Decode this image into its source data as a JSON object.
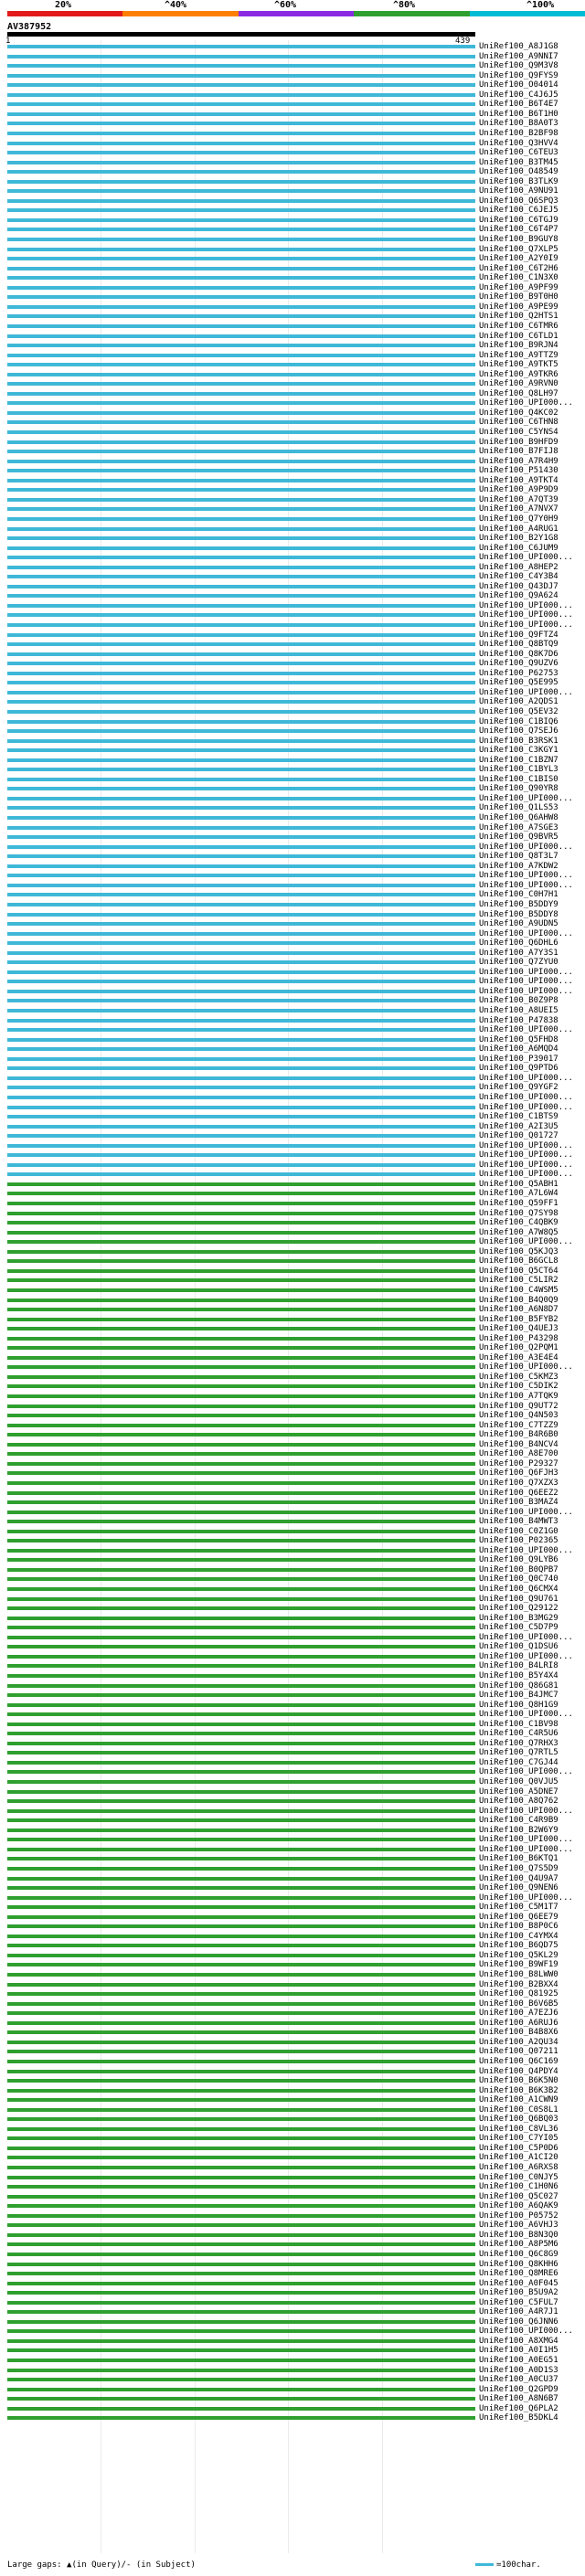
{
  "scale_labels": [
    "20%",
    "^40%",
    "^60%",
    "^80%",
    "^100%"
  ],
  "colorbar": [
    "#e31a1c",
    "#ff7f00",
    "#8a2be2",
    "#2fa02f",
    "#00bcd4"
  ],
  "query": {
    "title": "AV387952",
    "start": "1",
    "end": "439"
  },
  "footer": {
    "legend": "Large gaps: ▲(in Query)/- (in Subject)",
    "scale": "=100char."
  },
  "hits": [
    {
      "label": "UniRef100_A8J1G8",
      "color": "cyan"
    },
    {
      "label": "UniRef100_A9NNI7",
      "color": "cyan"
    },
    {
      "label": "UniRef100_Q9M3V8",
      "color": "cyan"
    },
    {
      "label": "UniRef100_Q9FYS9",
      "color": "cyan"
    },
    {
      "label": "UniRef100_O04014",
      "color": "cyan"
    },
    {
      "label": "UniRef100_C4J6J5",
      "color": "cyan"
    },
    {
      "label": "UniRef100_B6T4E7",
      "color": "cyan"
    },
    {
      "label": "UniRef100_B6T1H0",
      "color": "cyan"
    },
    {
      "label": "UniRef100_B8A0T3",
      "color": "cyan"
    },
    {
      "label": "UniRef100_B2BF98",
      "color": "cyan"
    },
    {
      "label": "UniRef100_Q3HVV4",
      "color": "cyan"
    },
    {
      "label": "UniRef100_C6TEU3",
      "color": "cyan"
    },
    {
      "label": "UniRef100_B3TM45",
      "color": "cyan"
    },
    {
      "label": "UniRef100_O48549",
      "color": "cyan"
    },
    {
      "label": "UniRef100_B3TLK9",
      "color": "cyan"
    },
    {
      "label": "UniRef100_A9NU91",
      "color": "cyan"
    },
    {
      "label": "UniRef100_Q6SPQ3",
      "color": "cyan"
    },
    {
      "label": "UniRef100_C6JEJ5",
      "color": "cyan"
    },
    {
      "label": "UniRef100_C6TGJ9",
      "color": "cyan"
    },
    {
      "label": "UniRef100_C6T4P7",
      "color": "cyan"
    },
    {
      "label": "UniRef100_B9GUY8",
      "color": "cyan"
    },
    {
      "label": "UniRef100_Q7XLP5",
      "color": "cyan"
    },
    {
      "label": "UniRef100_A2Y0I9",
      "color": "cyan"
    },
    {
      "label": "UniRef100_C6T2H6",
      "color": "cyan"
    },
    {
      "label": "UniRef100_C1N3X0",
      "color": "cyan"
    },
    {
      "label": "UniRef100_A9PF99",
      "color": "cyan"
    },
    {
      "label": "UniRef100_B9T0H0",
      "color": "cyan"
    },
    {
      "label": "UniRef100_A9PE99",
      "color": "cyan"
    },
    {
      "label": "UniRef100_Q2HTS1",
      "color": "cyan"
    },
    {
      "label": "UniRef100_C6TMR6",
      "color": "cyan"
    },
    {
      "label": "UniRef100_C6TLD1",
      "color": "cyan"
    },
    {
      "label": "UniRef100_B9RJN4",
      "color": "cyan"
    },
    {
      "label": "UniRef100_A9TTZ9",
      "color": "cyan"
    },
    {
      "label": "UniRef100_A9TKT5",
      "color": "cyan"
    },
    {
      "label": "UniRef100_A9TKR6",
      "color": "cyan"
    },
    {
      "label": "UniRef100_A9RVN0",
      "color": "cyan"
    },
    {
      "label": "UniRef100_Q8LH97",
      "color": "cyan"
    },
    {
      "label": "UniRef100_UPI000...",
      "color": "cyan"
    },
    {
      "label": "UniRef100_Q4KC02",
      "color": "cyan"
    },
    {
      "label": "UniRef100_C6THN8",
      "color": "cyan"
    },
    {
      "label": "UniRef100_C5YNS4",
      "color": "cyan"
    },
    {
      "label": "UniRef100_B9HFD9",
      "color": "cyan"
    },
    {
      "label": "UniRef100_B7FIJ8",
      "color": "cyan"
    },
    {
      "label": "UniRef100_A7R4H9",
      "color": "cyan"
    },
    {
      "label": "UniRef100_P51430",
      "color": "cyan"
    },
    {
      "label": "UniRef100_A9TKT4",
      "color": "cyan"
    },
    {
      "label": "UniRef100_A9P9D9",
      "color": "cyan"
    },
    {
      "label": "UniRef100_A7QT39",
      "color": "cyan"
    },
    {
      "label": "UniRef100_A7NVX7",
      "color": "cyan"
    },
    {
      "label": "UniRef100_Q7Y0H9",
      "color": "cyan"
    },
    {
      "label": "UniRef100_A4RUG1",
      "color": "cyan"
    },
    {
      "label": "UniRef100_B2Y1G8",
      "color": "cyan"
    },
    {
      "label": "UniRef100_C6JUM9",
      "color": "cyan"
    },
    {
      "label": "UniRef100_UPI000...",
      "color": "cyan"
    },
    {
      "label": "UniRef100_A8HEP2",
      "color": "cyan"
    },
    {
      "label": "UniRef100_C4Y3B4",
      "color": "cyan"
    },
    {
      "label": "UniRef100_Q43DJ7",
      "color": "cyan"
    },
    {
      "label": "UniRef100_Q9A624",
      "color": "cyan"
    },
    {
      "label": "UniRef100_UPI000...",
      "color": "cyan"
    },
    {
      "label": "UniRef100_UPI000...",
      "color": "cyan"
    },
    {
      "label": "UniRef100_UPI000...",
      "color": "cyan"
    },
    {
      "label": "UniRef100_Q9FTZ4",
      "color": "cyan"
    },
    {
      "label": "UniRef100_Q8BTQ9",
      "color": "cyan"
    },
    {
      "label": "UniRef100_Q8K7D6",
      "color": "cyan"
    },
    {
      "label": "UniRef100_Q9UZV6",
      "color": "cyan"
    },
    {
      "label": "UniRef100_P62753",
      "color": "cyan"
    },
    {
      "label": "UniRef100_Q5E995",
      "color": "cyan"
    },
    {
      "label": "UniRef100_UPI000...",
      "color": "cyan"
    },
    {
      "label": "UniRef100_A2QDS1",
      "color": "cyan"
    },
    {
      "label": "UniRef100_Q5EV32",
      "color": "cyan"
    },
    {
      "label": "UniRef100_C1BIQ6",
      "color": "cyan"
    },
    {
      "label": "UniRef100_Q7SEJ6",
      "color": "cyan"
    },
    {
      "label": "UniRef100_B3RSK1",
      "color": "cyan"
    },
    {
      "label": "UniRef100_C3KGY1",
      "color": "cyan"
    },
    {
      "label": "UniRef100_C1BZN7",
      "color": "cyan"
    },
    {
      "label": "UniRef100_C1BYL3",
      "color": "cyan"
    },
    {
      "label": "UniRef100_C1BIS0",
      "color": "cyan"
    },
    {
      "label": "UniRef100_Q90YR8",
      "color": "cyan"
    },
    {
      "label": "UniRef100_UPI000...",
      "color": "cyan"
    },
    {
      "label": "UniRef100_Q1LS53",
      "color": "cyan"
    },
    {
      "label": "UniRef100_Q6AHW8",
      "color": "cyan"
    },
    {
      "label": "UniRef100_A7SGE3",
      "color": "cyan"
    },
    {
      "label": "UniRef100_Q9BVR5",
      "color": "cyan"
    },
    {
      "label": "UniRef100_UPI000...",
      "color": "cyan"
    },
    {
      "label": "UniRef100_Q8T3L7",
      "color": "cyan"
    },
    {
      "label": "UniRef100_A7KDW2",
      "color": "cyan"
    },
    {
      "label": "UniRef100_UPI000...",
      "color": "cyan"
    },
    {
      "label": "UniRef100_UPI000...",
      "color": "cyan"
    },
    {
      "label": "UniRef100_C0H7H1",
      "color": "cyan"
    },
    {
      "label": "UniRef100_B5DDY9",
      "color": "cyan"
    },
    {
      "label": "UniRef100_B5DDY8",
      "color": "cyan"
    },
    {
      "label": "UniRef100_A9UDN5",
      "color": "cyan"
    },
    {
      "label": "UniRef100_UPI000...",
      "color": "cyan"
    },
    {
      "label": "UniRef100_Q6DHL6",
      "color": "cyan"
    },
    {
      "label": "UniRef100_A7Y3S1",
      "color": "cyan"
    },
    {
      "label": "UniRef100_Q7ZYU0",
      "color": "cyan"
    },
    {
      "label": "UniRef100_UPI000...",
      "color": "cyan"
    },
    {
      "label": "UniRef100_UPI000...",
      "color": "cyan"
    },
    {
      "label": "UniRef100_UPI000...",
      "color": "cyan"
    },
    {
      "label": "UniRef100_B0Z9P8",
      "color": "cyan"
    },
    {
      "label": "UniRef100_A8UEI5",
      "color": "cyan"
    },
    {
      "label": "UniRef100_P47838",
      "color": "cyan"
    },
    {
      "label": "UniRef100_UPI000...",
      "color": "cyan"
    },
    {
      "label": "UniRef100_Q5FHD8",
      "color": "cyan"
    },
    {
      "label": "UniRef100_A6MQD4",
      "color": "cyan"
    },
    {
      "label": "UniRef100_P39017",
      "color": "cyan"
    },
    {
      "label": "UniRef100_Q9PTD6",
      "color": "cyan"
    },
    {
      "label": "UniRef100_UPI000...",
      "color": "cyan"
    },
    {
      "label": "UniRef100_Q9YGF2",
      "color": "cyan"
    },
    {
      "label": "UniRef100_UPI000...",
      "color": "cyan"
    },
    {
      "label": "UniRef100_UPI000...",
      "color": "cyan"
    },
    {
      "label": "UniRef100_C1BTS9",
      "color": "cyan"
    },
    {
      "label": "UniRef100_A2I3U5",
      "color": "cyan"
    },
    {
      "label": "UniRef100_Q01727",
      "color": "cyan"
    },
    {
      "label": "UniRef100_UPI000...",
      "color": "cyan"
    },
    {
      "label": "UniRef100_UPI000...",
      "color": "cyan"
    },
    {
      "label": "UniRef100_UPI000...",
      "color": "cyan"
    },
    {
      "label": "UniRef100_UPI000...",
      "color": "cyan"
    },
    {
      "label": "UniRef100_Q5ABH1",
      "color": "green"
    },
    {
      "label": "UniRef100_A7L6W4",
      "color": "green"
    },
    {
      "label": "UniRef100_Q59FF1",
      "color": "green"
    },
    {
      "label": "UniRef100_Q7SY98",
      "color": "green"
    },
    {
      "label": "UniRef100_C4QBK9",
      "color": "green"
    },
    {
      "label": "UniRef100_A7W8Q5",
      "color": "green"
    },
    {
      "label": "UniRef100_UPI000...",
      "color": "green"
    },
    {
      "label": "UniRef100_Q5KJQ3",
      "color": "green"
    },
    {
      "label": "UniRef100_B6GCL8",
      "color": "green"
    },
    {
      "label": "UniRef100_Q5CT64",
      "color": "green"
    },
    {
      "label": "UniRef100_C5LIR2",
      "color": "green"
    },
    {
      "label": "UniRef100_C4WSM5",
      "color": "green"
    },
    {
      "label": "UniRef100_B4Q0Q9",
      "color": "green"
    },
    {
      "label": "UniRef100_A6N8D7",
      "color": "green"
    },
    {
      "label": "UniRef100_B5FYB2",
      "color": "green"
    },
    {
      "label": "UniRef100_Q4UEJ3",
      "color": "green"
    },
    {
      "label": "UniRef100_P43298",
      "color": "green"
    },
    {
      "label": "UniRef100_Q2PQM1",
      "color": "green"
    },
    {
      "label": "UniRef100_A3E4E4",
      "color": "green"
    },
    {
      "label": "UniRef100_UPI000...",
      "color": "green"
    },
    {
      "label": "UniRef100_C5KMZ3",
      "color": "green"
    },
    {
      "label": "UniRef100_C5DIK2",
      "color": "green"
    },
    {
      "label": "UniRef100_A7TQK9",
      "color": "green"
    },
    {
      "label": "UniRef100_Q9UT72",
      "color": "green"
    },
    {
      "label": "UniRef100_Q4N503",
      "color": "green"
    },
    {
      "label": "UniRef100_C7TZZ9",
      "color": "green"
    },
    {
      "label": "UniRef100_B4R6B0",
      "color": "green"
    },
    {
      "label": "UniRef100_B4NCV4",
      "color": "green"
    },
    {
      "label": "UniRef100_A8E700",
      "color": "green"
    },
    {
      "label": "UniRef100_P29327",
      "color": "green"
    },
    {
      "label": "UniRef100_Q6FJH3",
      "color": "green"
    },
    {
      "label": "UniRef100_Q7XZX3",
      "color": "green"
    },
    {
      "label": "UniRef100_Q6EEZ2",
      "color": "green"
    },
    {
      "label": "UniRef100_B3MAZ4",
      "color": "green"
    },
    {
      "label": "UniRef100_UPI000...",
      "color": "green"
    },
    {
      "label": "UniRef100_B4MWT3",
      "color": "green"
    },
    {
      "label": "UniRef100_C0Z1G0",
      "color": "green"
    },
    {
      "label": "UniRef100_P02365",
      "color": "green"
    },
    {
      "label": "UniRef100_UPI000...",
      "color": "green"
    },
    {
      "label": "UniRef100_Q9LYB6",
      "color": "green"
    },
    {
      "label": "UniRef100_B0QPB7",
      "color": "green"
    },
    {
      "label": "UniRef100_Q0C740",
      "color": "green"
    },
    {
      "label": "UniRef100_Q6CMX4",
      "color": "green"
    },
    {
      "label": "UniRef100_Q9U761",
      "color": "green"
    },
    {
      "label": "UniRef100_Q29122",
      "color": "green"
    },
    {
      "label": "UniRef100_B3MG29",
      "color": "green"
    },
    {
      "label": "UniRef100_C5D7P9",
      "color": "green"
    },
    {
      "label": "UniRef100_UPI000...",
      "color": "green"
    },
    {
      "label": "UniRef100_Q1DSU6",
      "color": "green"
    },
    {
      "label": "UniRef100_UPI000...",
      "color": "green"
    },
    {
      "label": "UniRef100_B4LRI8",
      "color": "green"
    },
    {
      "label": "UniRef100_B5Y4X4",
      "color": "green"
    },
    {
      "label": "UniRef100_Q86G81",
      "color": "green"
    },
    {
      "label": "UniRef100_B4JMC7",
      "color": "green"
    },
    {
      "label": "UniRef100_Q8H1G9",
      "color": "green"
    },
    {
      "label": "UniRef100_UPI000...",
      "color": "green"
    },
    {
      "label": "UniRef100_C1BV98",
      "color": "green"
    },
    {
      "label": "UniRef100_C4R5U6",
      "color": "green"
    },
    {
      "label": "UniRef100_Q7RHX3",
      "color": "green"
    },
    {
      "label": "UniRef100_Q7RTL5",
      "color": "green"
    },
    {
      "label": "UniRef100_C7GJ44",
      "color": "green"
    },
    {
      "label": "UniRef100_UPI000...",
      "color": "green"
    },
    {
      "label": "UniRef100_Q0VJU5",
      "color": "green"
    },
    {
      "label": "UniRef100_A5DNE7",
      "color": "green"
    },
    {
      "label": "UniRef100_A8Q762",
      "color": "green"
    },
    {
      "label": "UniRef100_UPI000...",
      "color": "green"
    },
    {
      "label": "UniRef100_C4R9B9",
      "color": "green"
    },
    {
      "label": "UniRef100_B2W6Y9",
      "color": "green"
    },
    {
      "label": "UniRef100_UPI000...",
      "color": "green"
    },
    {
      "label": "UniRef100_UPI000...",
      "color": "green"
    },
    {
      "label": "UniRef100_B6KTQ1",
      "color": "green"
    },
    {
      "label": "UniRef100_Q7S5D9",
      "color": "green"
    },
    {
      "label": "UniRef100_Q4U9A7",
      "color": "green"
    },
    {
      "label": "UniRef100_Q9NEN6",
      "color": "green"
    },
    {
      "label": "UniRef100_UPI000...",
      "color": "green"
    },
    {
      "label": "UniRef100_C5M1T7",
      "color": "green"
    },
    {
      "label": "UniRef100_Q6EE79",
      "color": "green"
    },
    {
      "label": "UniRef100_B8P0C6",
      "color": "green"
    },
    {
      "label": "UniRef100_C4YMX4",
      "color": "green"
    },
    {
      "label": "UniRef100_B6QD75",
      "color": "green"
    },
    {
      "label": "UniRef100_Q5KL29",
      "color": "green"
    },
    {
      "label": "UniRef100_B9WF19",
      "color": "green"
    },
    {
      "label": "UniRef100_B8LWW0",
      "color": "green"
    },
    {
      "label": "UniRef100_B2BXX4",
      "color": "green"
    },
    {
      "label": "UniRef100_Q81925",
      "color": "green"
    },
    {
      "label": "UniRef100_B6V6B5",
      "color": "green"
    },
    {
      "label": "UniRef100_A7EZJ6",
      "color": "green"
    },
    {
      "label": "UniRef100_A6RUJ6",
      "color": "green"
    },
    {
      "label": "UniRef100_B4B8X6",
      "color": "green"
    },
    {
      "label": "UniRef100_A2QU34",
      "color": "green"
    },
    {
      "label": "UniRef100_Q07211",
      "color": "green"
    },
    {
      "label": "UniRef100_Q6C169",
      "color": "green"
    },
    {
      "label": "UniRef100_Q4PDY4",
      "color": "green"
    },
    {
      "label": "UniRef100_B6K5N0",
      "color": "green"
    },
    {
      "label": "UniRef100_B6K3B2",
      "color": "green"
    },
    {
      "label": "UniRef100_A1CWN9",
      "color": "green"
    },
    {
      "label": "UniRef100_C0S8L1",
      "color": "green"
    },
    {
      "label": "UniRef100_Q6BQ03",
      "color": "green"
    },
    {
      "label": "UniRef100_C8VL36",
      "color": "green"
    },
    {
      "label": "UniRef100_C7YI05",
      "color": "green"
    },
    {
      "label": "UniRef100_C5P0D6",
      "color": "green"
    },
    {
      "label": "UniRef100_A1CI20",
      "color": "green"
    },
    {
      "label": "UniRef100_A6RXS8",
      "color": "green"
    },
    {
      "label": "UniRef100_C0NJY5",
      "color": "green"
    },
    {
      "label": "UniRef100_C1H0N6",
      "color": "green"
    },
    {
      "label": "UniRef100_Q5C027",
      "color": "green"
    },
    {
      "label": "UniRef100_A6QAK9",
      "color": "green"
    },
    {
      "label": "UniRef100_P05752",
      "color": "green"
    },
    {
      "label": "UniRef100_A6VHJ3",
      "color": "green"
    },
    {
      "label": "UniRef100_B8N3Q0",
      "color": "green"
    },
    {
      "label": "UniRef100_A8P5M6",
      "color": "green"
    },
    {
      "label": "UniRef100_Q6C8G9",
      "color": "green"
    },
    {
      "label": "UniRef100_Q8KHH6",
      "color": "green"
    },
    {
      "label": "UniRef100_Q8MRE6",
      "color": "green"
    },
    {
      "label": "UniRef100_A0F045",
      "color": "green"
    },
    {
      "label": "UniRef100_B5U9A2",
      "color": "green"
    },
    {
      "label": "UniRef100_C5FUL7",
      "color": "green"
    },
    {
      "label": "UniRef100_A4R7J1",
      "color": "green"
    },
    {
      "label": "UniRef100_Q6JNN6",
      "color": "green"
    },
    {
      "label": "UniRef100_UPI000...",
      "color": "green"
    },
    {
      "label": "UniRef100_A8XMG4",
      "color": "green"
    },
    {
      "label": "UniRef100_A0I1H5",
      "color": "green"
    },
    {
      "label": "UniRef100_A0EG51",
      "color": "green"
    },
    {
      "label": "UniRef100_A0D1S3",
      "color": "green"
    },
    {
      "label": "UniRef100_A0CU37",
      "color": "green"
    },
    {
      "label": "UniRef100_Q2GPD9",
      "color": "green"
    },
    {
      "label": "UniRef100_A8N6B7",
      "color": "green"
    },
    {
      "label": "UniRef100_Q6PLA2",
      "color": "green"
    },
    {
      "label": "UniRef100_B5DKL4",
      "color": "green"
    }
  ]
}
